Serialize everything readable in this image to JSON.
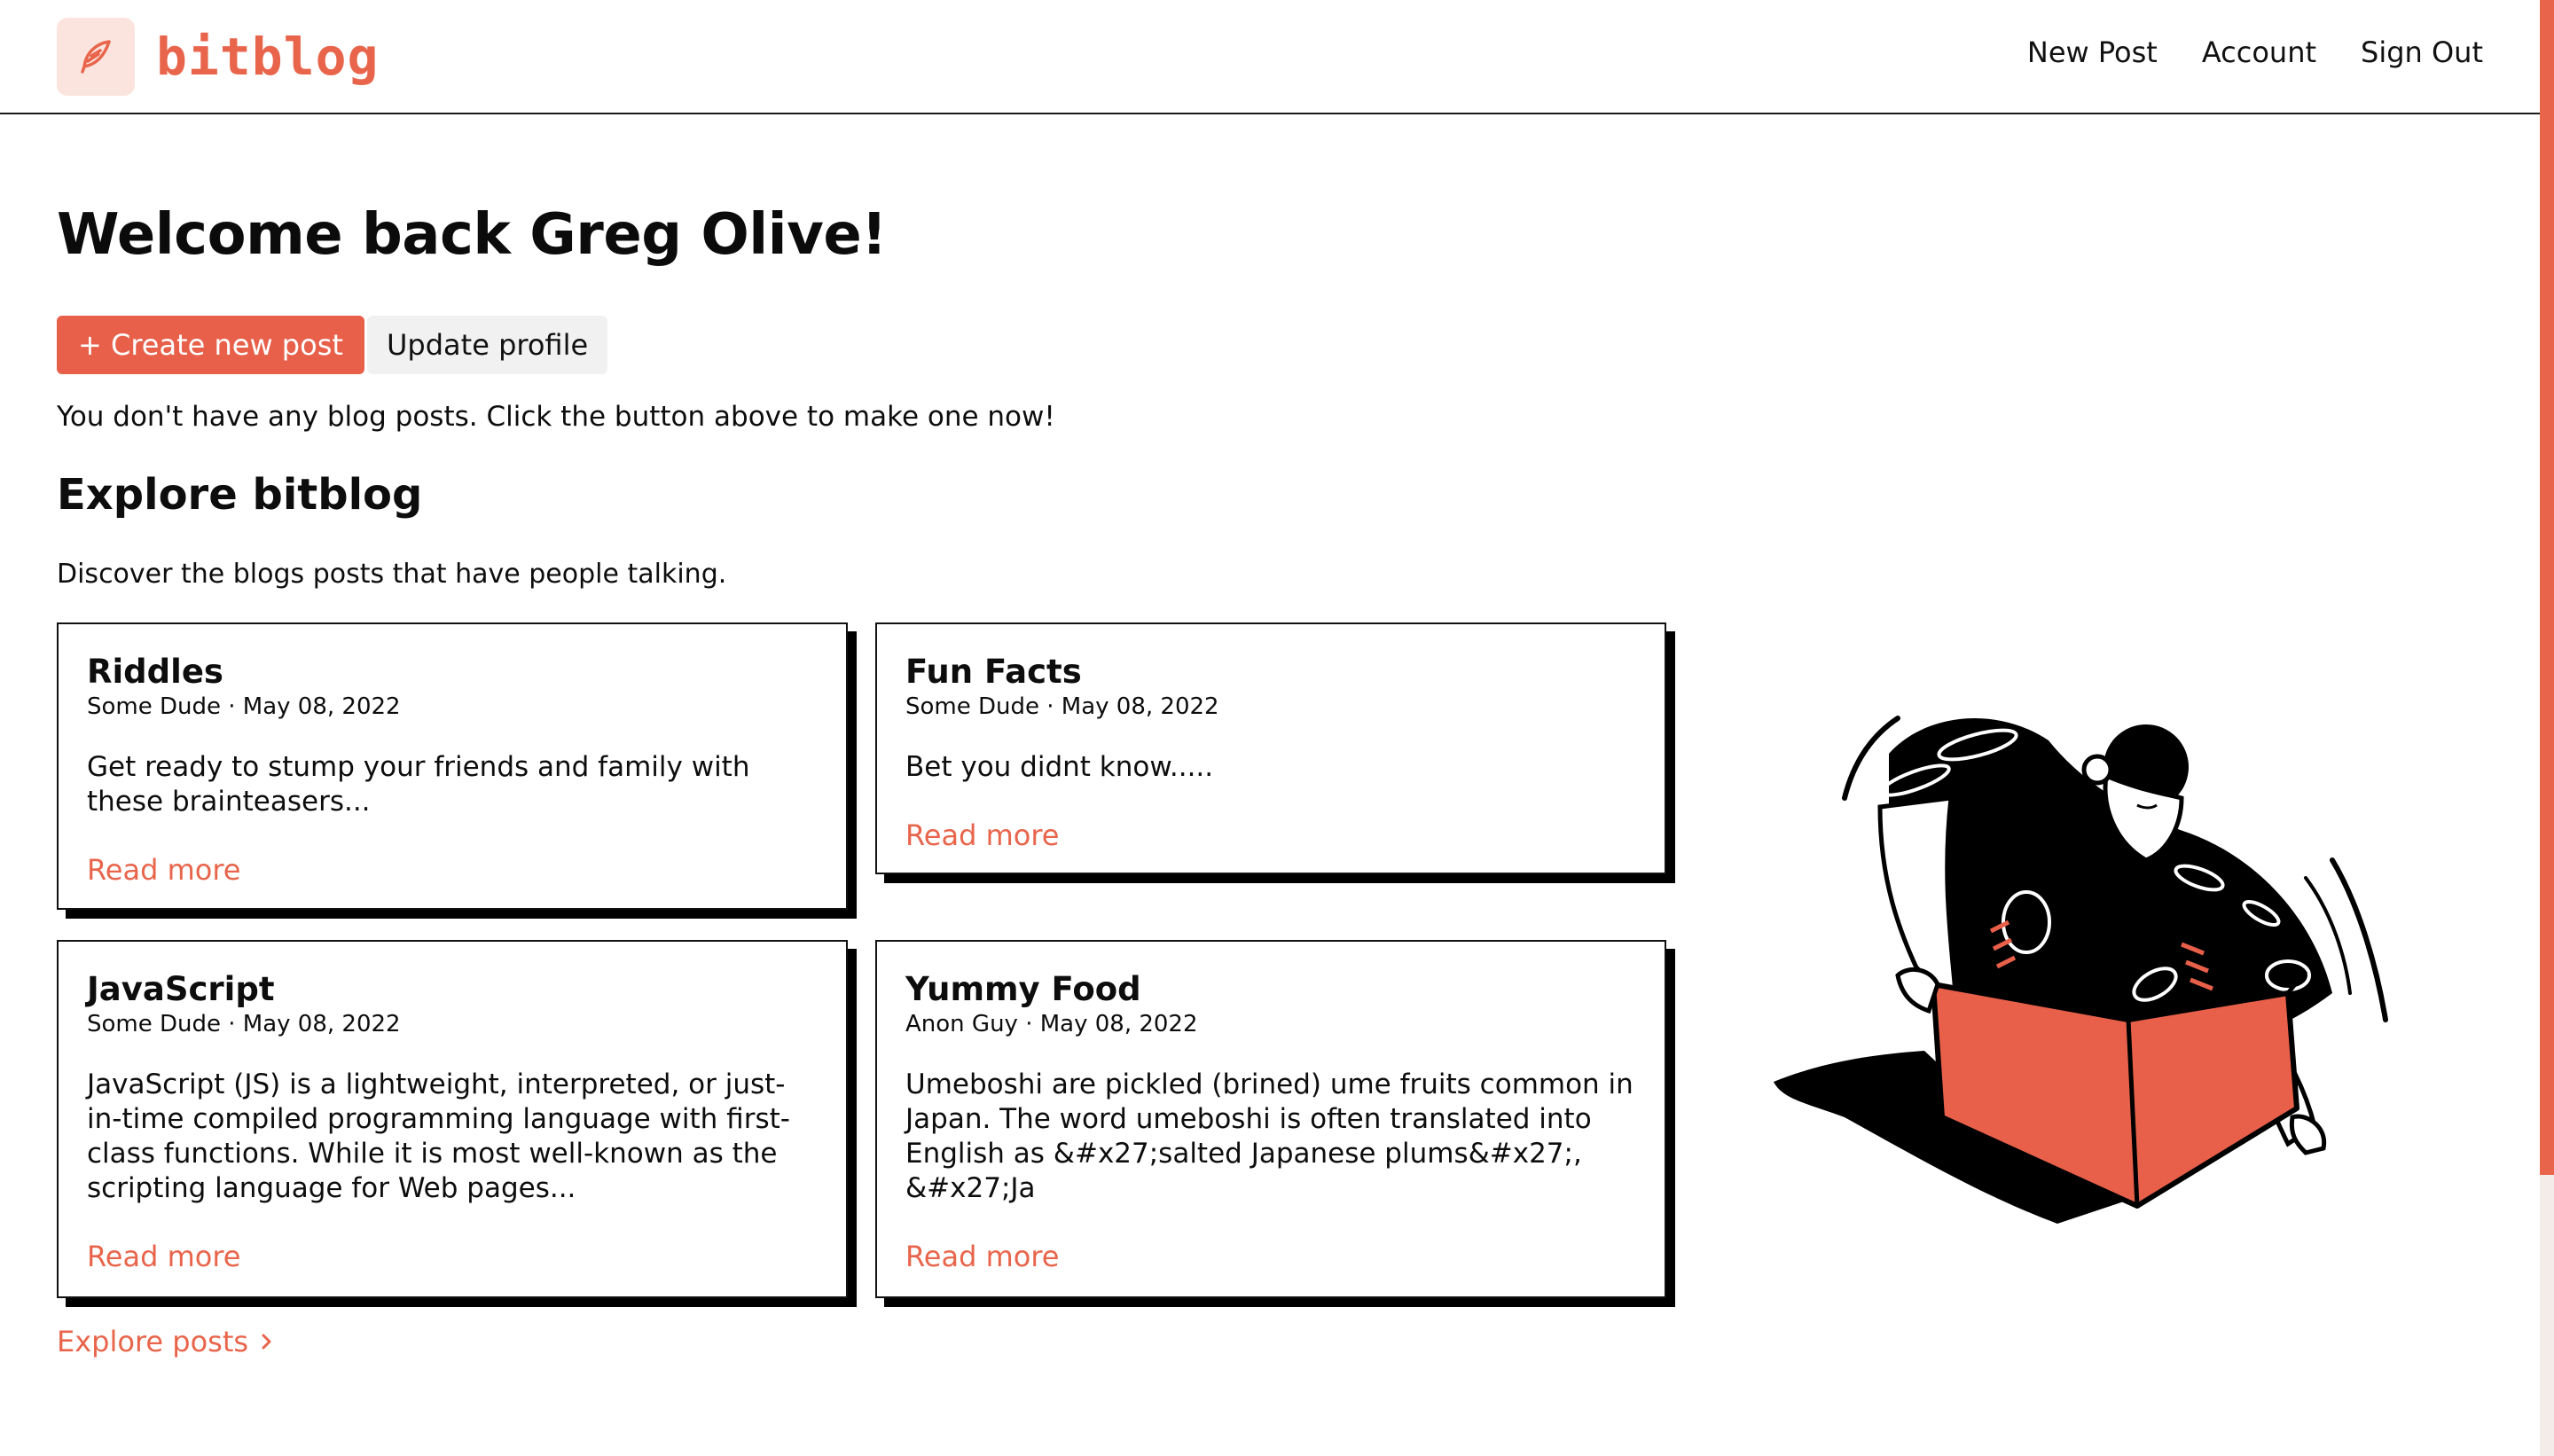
{
  "header": {
    "brand": "bitblog",
    "nav": [
      "New Post",
      "Account",
      "Sign Out"
    ]
  },
  "main": {
    "welcome": "Welcome back Greg Olive!",
    "create_button": "+ Create new post",
    "profile_button": "Update profile",
    "empty_message": "You don't have any blog posts. Click the button above to make one now!",
    "explore_heading": "Explore bitblog",
    "explore_subtitle": "Discover the blogs posts that have people talking.",
    "explore_link": "Explore posts",
    "posts": [
      {
        "title": "Riddles",
        "meta": "Some Dude · May 08, 2022",
        "excerpt": "Get ready to stump your friends and family with these brainteasers...",
        "link": "Read more"
      },
      {
        "title": "Fun Facts",
        "meta": "Some Dude · May 08, 2022",
        "excerpt": "Bet you didnt know.....",
        "link": "Read more"
      },
      {
        "title": "JavaScript",
        "meta": "Some Dude · May 08, 2022",
        "excerpt": "JavaScript (JS) is a lightweight, interpreted, or just-in-time compiled programming language with first-class functions. While it is most well-known as the scripting language for Web pages...",
        "link": "Read more"
      },
      {
        "title": "Yummy Food",
        "meta": "Anon Guy · May 08, 2022",
        "excerpt": "Umeboshi are pickled (brined) ume fruits common in Japan. The word umeboshi is often translated into English as &#x27;salted Japanese plums&#x27;, &#x27;Ja",
        "link": "Read more"
      }
    ]
  },
  "colors": {
    "accent": "#e8654b",
    "logo_bg": "#fce4de",
    "shadow": "#000000"
  },
  "icons": {
    "logo": "feather-icon",
    "explore_arrow": "chevron-right-icon"
  }
}
